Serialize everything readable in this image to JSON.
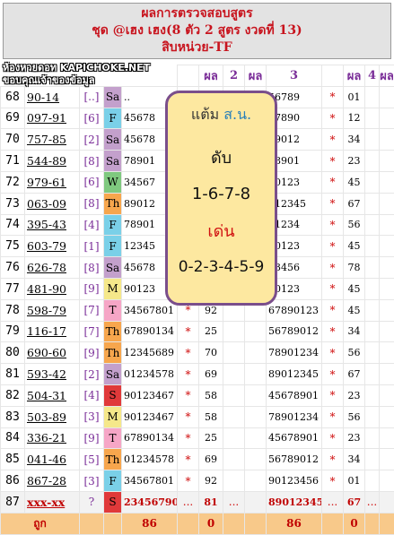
{
  "header": {
    "title": "ผลการตรวจสอบสูตร",
    "line2": "ชุด @เฮง เฮง(8 ตัว 2 สูตร งวดที่ 13)",
    "line3": "สิบหน่วย-TF"
  },
  "watermark": {
    "line1": "ห้องหวยดอท KAPICHOKE.NET",
    "line2": "ขอบคุณเจ้าของข้อมูล"
  },
  "columns": [
    "ผล",
    "2",
    "ผล",
    "3",
    "ผล",
    "4",
    "ผล"
  ],
  "colors": {
    "star": "#d01010",
    "pair": "#7a2d98",
    "total_bg": "#f8c98a",
    "popup_bg": "#fde8a0",
    "popup_border": "#7a4e8b"
  },
  "popup": {
    "title_a": "แต้ม ",
    "title_b": "ส.น.",
    "dub_label": "ดับ",
    "dub_value": "1-6-7-8",
    "den_label": "เด่น",
    "den_value": "0-2-3-4-5-9"
  },
  "rows": [
    {
      "no": "68",
      "pair": "90-14",
      "dn": "[..]",
      "day": "Sa",
      "day_bg": "#c3a0cc",
      "set1": "..",
      "s1": "",
      "v1": "",
      "s2": "",
      "v2": "",
      "set3": "56789",
      "s3": "*",
      "v3": "01",
      "s4": "",
      "v4": ""
    },
    {
      "no": "69",
      "pair": "097-91",
      "dn": "[6]",
      "day": "F",
      "day_bg": "#7ad0e8",
      "set1": "45678",
      "s1": "",
      "v1": "",
      "s2": "",
      "v2": "",
      "set3": "67890",
      "s3": "*",
      "v3": "12",
      "s4": "",
      "v4": ""
    },
    {
      "no": "70",
      "pair": "757-85",
      "dn": "[2]",
      "day": "Sa",
      "day_bg": "#c3a0cc",
      "set1": "45678",
      "s1": "",
      "v1": "",
      "s2": "",
      "v2": "",
      "set3": "89012",
      "s3": "*",
      "v3": "34",
      "s4": "",
      "v4": ""
    },
    {
      "no": "71",
      "pair": "544-89",
      "dn": "[8]",
      "day": "Sa",
      "day_bg": "#c3a0cc",
      "set1": "78901",
      "s1": "",
      "v1": "",
      "s2": "",
      "v2": "",
      "set3": "78901",
      "s3": "*",
      "v3": "23",
      "s4": "",
      "v4": ""
    },
    {
      "no": "72",
      "pair": "979-61",
      "dn": "[6]",
      "day": "W",
      "day_bg": "#7fc97f",
      "set1": "34567",
      "s1": "",
      "v1": "",
      "s2": "",
      "v2": "",
      "set3": "90123",
      "s3": "*",
      "v3": "45",
      "s4": "",
      "v4": ""
    },
    {
      "no": "73",
      "pair": "063-09",
      "dn": "[8]",
      "day": "Th",
      "day_bg": "#f7a64d",
      "set1": "89012",
      "s1": "",
      "v1": "",
      "s2": "",
      "v2": "",
      "set3": "012345",
      "s3": "*",
      "v3": "67",
      "s4": "",
      "v4": ""
    },
    {
      "no": "74",
      "pair": "395-43",
      "dn": "[4]",
      "day": "F",
      "day_bg": "#7ad0e8",
      "set1": "78901",
      "s1": "",
      "v1": "",
      "s2": "",
      "v2": "",
      "set3": "01234",
      "s3": "*",
      "v3": "56",
      "s4": "",
      "v4": ""
    },
    {
      "no": "75",
      "pair": "603-79",
      "dn": "[1]",
      "day": "F",
      "day_bg": "#7ad0e8",
      "set1": "12345",
      "s1": "",
      "v1": "",
      "s2": "",
      "v2": "",
      "set3": "90123",
      "s3": "*",
      "v3": "45",
      "s4": "",
      "v4": ""
    },
    {
      "no": "76",
      "pair": "626-78",
      "dn": "[8]",
      "day": "Sa",
      "day_bg": "#c3a0cc",
      "set1": "45678",
      "s1": "",
      "v1": "",
      "s2": "",
      "v2": "",
      "set3": "23456",
      "s3": "*",
      "v3": "78",
      "s4": "",
      "v4": ""
    },
    {
      "no": "77",
      "pair": "481-90",
      "dn": "[9]",
      "day": "M",
      "day_bg": "#f5e88a",
      "set1": "90123",
      "s1": "",
      "v1": "",
      "s2": "",
      "v2": "",
      "set3": "90123",
      "s3": "*",
      "v3": "45",
      "s4": "",
      "v4": ""
    },
    {
      "no": "78",
      "pair": "598-79",
      "dn": "[7]",
      "day": "T",
      "day_bg": "#f6a6c6",
      "set1": "34567801",
      "s1": "*",
      "v1": "92",
      "s2": "",
      "v2": "",
      "set3": "67890123",
      "s3": "*",
      "v3": "45",
      "s4": "",
      "v4": ""
    },
    {
      "no": "79",
      "pair": "116-17",
      "dn": "[7]",
      "day": "Th",
      "day_bg": "#f7a64d",
      "set1": "67890134",
      "s1": "*",
      "v1": "25",
      "s2": "",
      "v2": "",
      "set3": "56789012",
      "s3": "*",
      "v3": "34",
      "s4": "",
      "v4": ""
    },
    {
      "no": "80",
      "pair": "690-60",
      "dn": "[9]",
      "day": "Th",
      "day_bg": "#f7a64d",
      "set1": "12345689",
      "s1": "*",
      "v1": "70",
      "s2": "",
      "v2": "",
      "set3": "78901234",
      "s3": "*",
      "v3": "56",
      "s4": "",
      "v4": ""
    },
    {
      "no": "81",
      "pair": "593-42",
      "dn": "[2]",
      "day": "Sa",
      "day_bg": "#c3a0cc",
      "set1": "01234578",
      "s1": "*",
      "v1": "69",
      "s2": "",
      "v2": "",
      "set3": "89012345",
      "s3": "*",
      "v3": "67",
      "s4": "",
      "v4": ""
    },
    {
      "no": "82",
      "pair": "504-31",
      "dn": "[4]",
      "day": "S",
      "day_bg": "#e0393a",
      "set1": "90123467",
      "s1": "*",
      "v1": "58",
      "s2": "",
      "v2": "",
      "set3": "45678901",
      "s3": "*",
      "v3": "23",
      "s4": "",
      "v4": ""
    },
    {
      "no": "83",
      "pair": "503-89",
      "dn": "[3]",
      "day": "M",
      "day_bg": "#f5e88a",
      "set1": "90123467",
      "s1": "*",
      "v1": "58",
      "s2": "",
      "v2": "",
      "set3": "78901234",
      "s3": "*",
      "v3": "56",
      "s4": "",
      "v4": ""
    },
    {
      "no": "84",
      "pair": "336-21",
      "dn": "[9]",
      "day": "T",
      "day_bg": "#f6a6c6",
      "set1": "67890134",
      "s1": "*",
      "v1": "25",
      "s2": "",
      "v2": "",
      "set3": "45678901",
      "s3": "*",
      "v3": "23",
      "s4": "",
      "v4": ""
    },
    {
      "no": "85",
      "pair": "041-46",
      "dn": "[5]",
      "day": "Th",
      "day_bg": "#f7a64d",
      "set1": "01234578",
      "s1": "*",
      "v1": "69",
      "s2": "",
      "v2": "",
      "set3": "56789012",
      "s3": "*",
      "v3": "34",
      "s4": "",
      "v4": ""
    },
    {
      "no": "86",
      "pair": "867-28",
      "dn": "[3]",
      "day": "F",
      "day_bg": "#7ad0e8",
      "set1": "34567801",
      "s1": "*",
      "v1": "92",
      "s2": "",
      "v2": "",
      "set3": "90123456",
      "s3": "*",
      "v3": "01",
      "s4": "",
      "v4": ""
    }
  ],
  "current": {
    "no": "87",
    "pair": "xxx-xx",
    "dn": "?",
    "day": "S",
    "day_bg": "#e0393a",
    "set1": "23456790",
    "s1": "...",
    "v1": "81",
    "s2": "...",
    "v2": "",
    "set3": "89012345",
    "s3": "...",
    "v3": "67",
    "s4": "...",
    "v4": ""
  },
  "totals": {
    "label": "ถูก",
    "t1": "86",
    "t2": "0",
    "t3": "86",
    "t4": "0"
  }
}
